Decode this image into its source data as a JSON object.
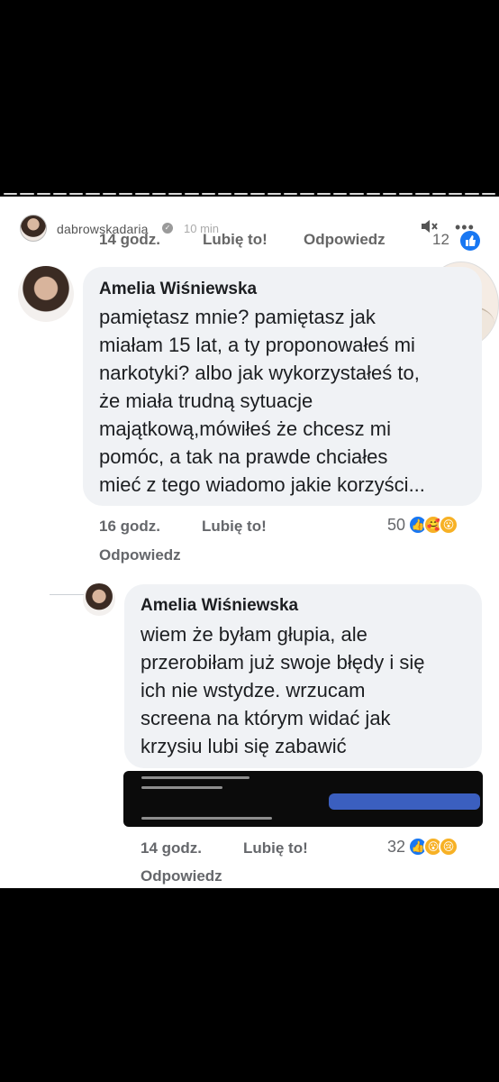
{
  "story": {
    "username": "dabrowskadaria",
    "time": "10 min",
    "mute_icon": "mute-icon",
    "more_icon": "more-options-icon"
  },
  "prev_comment": {
    "time": "14 godz.",
    "like_label": "Lubię to!",
    "reply_label": "Odpowiedz",
    "reaction_count": "12"
  },
  "comment1": {
    "author": "Amelia Wiśniewska",
    "lines": [
      "pamiętasz mnie? pamiętasz jak",
      "miałam 15 lat, a ty  proponowałeś mi",
      "narkotyki? albo jak wykorzystałeś to,",
      "że miała trudną sytuacje",
      "majątkową,mówiłeś że chcesz mi",
      "pomóc, a tak na prawde chciałes",
      "mieć z tego wiadomo jakie korzyści..."
    ],
    "time": "16 godz.",
    "like_label": "Lubię to!",
    "reply_label": "Odpowiedz",
    "reaction_count": "50"
  },
  "comment2": {
    "author": "Amelia Wiśniewska",
    "lines": [
      "wiem że byłam głupia, ale",
      "przerobiłam już swoje błędy i się",
      "ich nie wstydze. wrzucam",
      "screena na którym widać jak",
      "krzysiu lubi się zabawić"
    ],
    "time": "14 godz.",
    "like_label": "Lubię to!",
    "reply_label": "Odpowiedz",
    "reaction_count": "32"
  }
}
